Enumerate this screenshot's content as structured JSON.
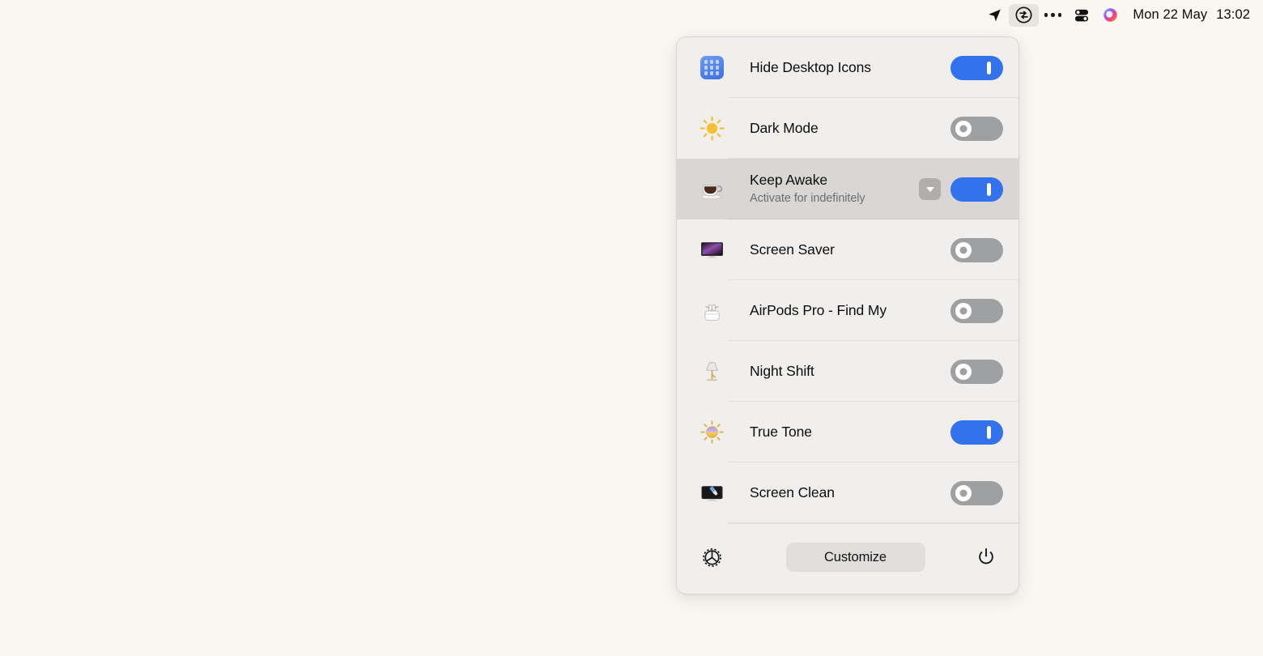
{
  "menubar": {
    "items": [
      {
        "name": "location-arrow-icon",
        "label": ""
      },
      {
        "name": "one-switch-icon",
        "label": "",
        "active": true
      },
      {
        "name": "more-dots-icon",
        "label": ""
      },
      {
        "name": "control-center-icon",
        "label": ""
      },
      {
        "name": "siri-icon",
        "label": ""
      }
    ],
    "date": "Mon 22 May",
    "time": "13:02"
  },
  "panel": {
    "rows": [
      {
        "icon": "launchpad-icon",
        "title": "Hide Desktop Icons",
        "subtitle": "",
        "toggle": "on",
        "has_chevron": false,
        "highlighted": false
      },
      {
        "icon": "sun-icon",
        "title": "Dark Mode",
        "subtitle": "",
        "toggle": "off",
        "has_chevron": false,
        "highlighted": false
      },
      {
        "icon": "coffee-cup-icon",
        "title": "Keep Awake",
        "subtitle": "Activate for indefinitely",
        "toggle": "on",
        "has_chevron": true,
        "highlighted": true
      },
      {
        "icon": "display-screensaver-icon",
        "title": "Screen Saver",
        "subtitle": "",
        "toggle": "off",
        "has_chevron": false,
        "highlighted": false
      },
      {
        "icon": "airpods-icon",
        "title": "AirPods Pro - Find My",
        "subtitle": "",
        "toggle": "off",
        "has_chevron": false,
        "highlighted": false
      },
      {
        "icon": "desk-lamp-icon",
        "title": "Night Shift",
        "subtitle": "",
        "toggle": "off",
        "has_chevron": false,
        "highlighted": false
      },
      {
        "icon": "true-tone-sun-icon",
        "title": "True Tone",
        "subtitle": "",
        "toggle": "on",
        "has_chevron": false,
        "highlighted": false
      },
      {
        "icon": "monitor-brush-icon",
        "title": "Screen Clean",
        "subtitle": "",
        "toggle": "off",
        "has_chevron": false,
        "highlighted": false
      }
    ],
    "footer": {
      "settings_icon": "gear-icon",
      "customize_label": "Customize",
      "power_icon": "power-icon"
    }
  },
  "colors": {
    "desktop_background": "#FAF7F3",
    "panel_background": "#F0EFEE",
    "toggle_on": "#3272ED",
    "toggle_off": "#9FA0A2",
    "row_highlight": "#D8D7D5",
    "customize_button": "#E0DFDD",
    "divider": "#E1E0DE",
    "title_text": "#0D0D0D",
    "subtitle_text": "#6E6E70"
  }
}
